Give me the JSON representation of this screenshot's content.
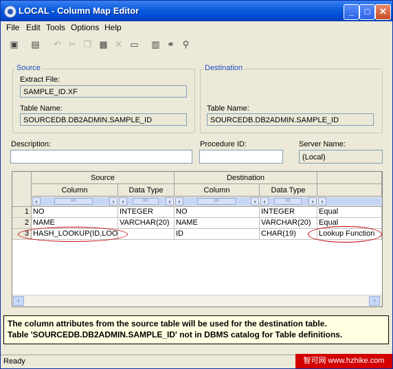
{
  "window": {
    "title": "LOCAL - Column Map Editor"
  },
  "menu": [
    "File",
    "Edit",
    "Tools",
    "Options",
    "Help"
  ],
  "toolbar_icons": [
    "new-icon",
    "print-icon",
    "undo-icon",
    "cut-icon",
    "copy-icon",
    "paste-icon",
    "delete-icon",
    "rectangle-icon",
    "grid-icon",
    "binoculars-icon",
    "search-icon"
  ],
  "source": {
    "legend": "Source",
    "extract_file_label": "Extract File:",
    "extract_file_value": "SAMPLE_ID.XF",
    "table_name_label": "Table Name:",
    "table_name_value": "SOURCEDB.DB2ADMIN.SAMPLE_ID"
  },
  "destination": {
    "legend": "Destination",
    "table_name_label": "Table Name:",
    "table_name_value": "SOURCEDB.DB2ADMIN.SAMPLE_ID"
  },
  "description": {
    "label": "Description:",
    "value": ""
  },
  "procedure": {
    "label": "Procedure ID:",
    "value": ""
  },
  "server": {
    "label": "Server Name:",
    "value": "(Local)"
  },
  "grid": {
    "group_headers": {
      "source": "Source",
      "destination": "Destination"
    },
    "column_headers": [
      "Column",
      "Data Type",
      "Column",
      "Data Type"
    ],
    "scroll_grip": "IIII",
    "rows": [
      {
        "num": "1",
        "src_col": "NO",
        "src_type": "INTEGER",
        "dst_col": "NO",
        "dst_type": "INTEGER",
        "status": "Equal"
      },
      {
        "num": "2",
        "src_col": "NAME",
        "src_type": "VARCHAR(20)",
        "dst_col": "NAME",
        "dst_type": "VARCHAR(20)",
        "status": "Equal"
      },
      {
        "num": "3",
        "src_col": "HASH_LOOKUP(ID,LOOK",
        "src_type": "",
        "dst_col": "ID",
        "dst_type": "CHAR(19)",
        "status": "Lookup Function"
      }
    ]
  },
  "message": {
    "line1": "The column attributes from the source table will be used for the destination table.",
    "line2": "Table 'SOURCEDB.DB2ADMIN.SAMPLE_ID' not in DBMS catalog for Table definitions."
  },
  "status": {
    "text": "Ready"
  },
  "watermark": "智可网 www.hzhike.com",
  "colors": {
    "title_bar": "#0a5bdc",
    "legend": "#1f50c8",
    "annotation": "#c00000",
    "message_bg": "#ffffe1"
  }
}
